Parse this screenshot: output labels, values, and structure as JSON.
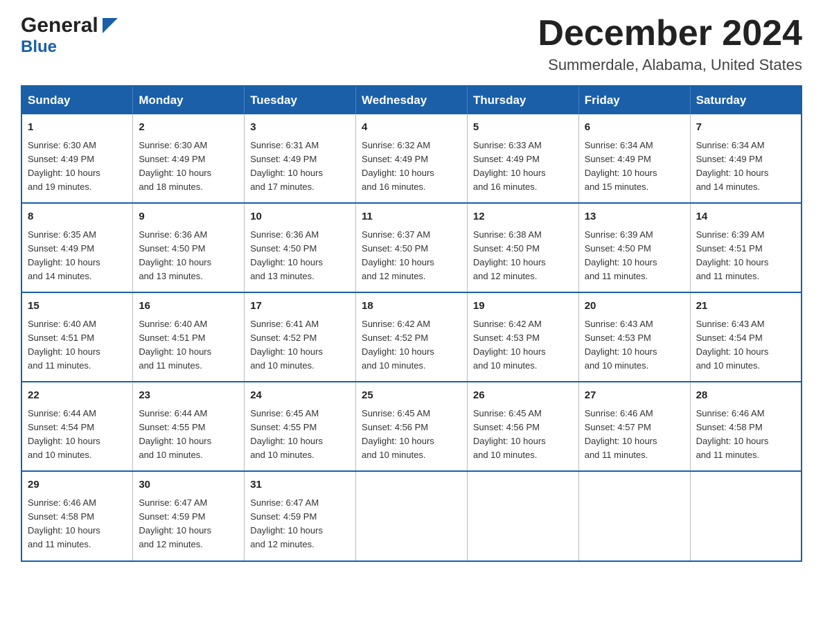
{
  "header": {
    "logo_general": "General",
    "logo_blue": "Blue",
    "month_title": "December 2024",
    "subtitle": "Summerdale, Alabama, United States"
  },
  "days_of_week": [
    "Sunday",
    "Monday",
    "Tuesday",
    "Wednesday",
    "Thursday",
    "Friday",
    "Saturday"
  ],
  "weeks": [
    [
      {
        "day": "1",
        "sunrise": "6:30 AM",
        "sunset": "4:49 PM",
        "daylight": "10 hours and 19 minutes."
      },
      {
        "day": "2",
        "sunrise": "6:30 AM",
        "sunset": "4:49 PM",
        "daylight": "10 hours and 18 minutes."
      },
      {
        "day": "3",
        "sunrise": "6:31 AM",
        "sunset": "4:49 PM",
        "daylight": "10 hours and 17 minutes."
      },
      {
        "day": "4",
        "sunrise": "6:32 AM",
        "sunset": "4:49 PM",
        "daylight": "10 hours and 16 minutes."
      },
      {
        "day": "5",
        "sunrise": "6:33 AM",
        "sunset": "4:49 PM",
        "daylight": "10 hours and 16 minutes."
      },
      {
        "day": "6",
        "sunrise": "6:34 AM",
        "sunset": "4:49 PM",
        "daylight": "10 hours and 15 minutes."
      },
      {
        "day": "7",
        "sunrise": "6:34 AM",
        "sunset": "4:49 PM",
        "daylight": "10 hours and 14 minutes."
      }
    ],
    [
      {
        "day": "8",
        "sunrise": "6:35 AM",
        "sunset": "4:49 PM",
        "daylight": "10 hours and 14 minutes."
      },
      {
        "day": "9",
        "sunrise": "6:36 AM",
        "sunset": "4:50 PM",
        "daylight": "10 hours and 13 minutes."
      },
      {
        "day": "10",
        "sunrise": "6:36 AM",
        "sunset": "4:50 PM",
        "daylight": "10 hours and 13 minutes."
      },
      {
        "day": "11",
        "sunrise": "6:37 AM",
        "sunset": "4:50 PM",
        "daylight": "10 hours and 12 minutes."
      },
      {
        "day": "12",
        "sunrise": "6:38 AM",
        "sunset": "4:50 PM",
        "daylight": "10 hours and 12 minutes."
      },
      {
        "day": "13",
        "sunrise": "6:39 AM",
        "sunset": "4:50 PM",
        "daylight": "10 hours and 11 minutes."
      },
      {
        "day": "14",
        "sunrise": "6:39 AM",
        "sunset": "4:51 PM",
        "daylight": "10 hours and 11 minutes."
      }
    ],
    [
      {
        "day": "15",
        "sunrise": "6:40 AM",
        "sunset": "4:51 PM",
        "daylight": "10 hours and 11 minutes."
      },
      {
        "day": "16",
        "sunrise": "6:40 AM",
        "sunset": "4:51 PM",
        "daylight": "10 hours and 11 minutes."
      },
      {
        "day": "17",
        "sunrise": "6:41 AM",
        "sunset": "4:52 PM",
        "daylight": "10 hours and 10 minutes."
      },
      {
        "day": "18",
        "sunrise": "6:42 AM",
        "sunset": "4:52 PM",
        "daylight": "10 hours and 10 minutes."
      },
      {
        "day": "19",
        "sunrise": "6:42 AM",
        "sunset": "4:53 PM",
        "daylight": "10 hours and 10 minutes."
      },
      {
        "day": "20",
        "sunrise": "6:43 AM",
        "sunset": "4:53 PM",
        "daylight": "10 hours and 10 minutes."
      },
      {
        "day": "21",
        "sunrise": "6:43 AM",
        "sunset": "4:54 PM",
        "daylight": "10 hours and 10 minutes."
      }
    ],
    [
      {
        "day": "22",
        "sunrise": "6:44 AM",
        "sunset": "4:54 PM",
        "daylight": "10 hours and 10 minutes."
      },
      {
        "day": "23",
        "sunrise": "6:44 AM",
        "sunset": "4:55 PM",
        "daylight": "10 hours and 10 minutes."
      },
      {
        "day": "24",
        "sunrise": "6:45 AM",
        "sunset": "4:55 PM",
        "daylight": "10 hours and 10 minutes."
      },
      {
        "day": "25",
        "sunrise": "6:45 AM",
        "sunset": "4:56 PM",
        "daylight": "10 hours and 10 minutes."
      },
      {
        "day": "26",
        "sunrise": "6:45 AM",
        "sunset": "4:56 PM",
        "daylight": "10 hours and 10 minutes."
      },
      {
        "day": "27",
        "sunrise": "6:46 AM",
        "sunset": "4:57 PM",
        "daylight": "10 hours and 11 minutes."
      },
      {
        "day": "28",
        "sunrise": "6:46 AM",
        "sunset": "4:58 PM",
        "daylight": "10 hours and 11 minutes."
      }
    ],
    [
      {
        "day": "29",
        "sunrise": "6:46 AM",
        "sunset": "4:58 PM",
        "daylight": "10 hours and 11 minutes."
      },
      {
        "day": "30",
        "sunrise": "6:47 AM",
        "sunset": "4:59 PM",
        "daylight": "10 hours and 12 minutes."
      },
      {
        "day": "31",
        "sunrise": "6:47 AM",
        "sunset": "4:59 PM",
        "daylight": "10 hours and 12 minutes."
      },
      null,
      null,
      null,
      null
    ]
  ],
  "labels": {
    "sunrise": "Sunrise:",
    "sunset": "Sunset:",
    "daylight": "Daylight:"
  }
}
